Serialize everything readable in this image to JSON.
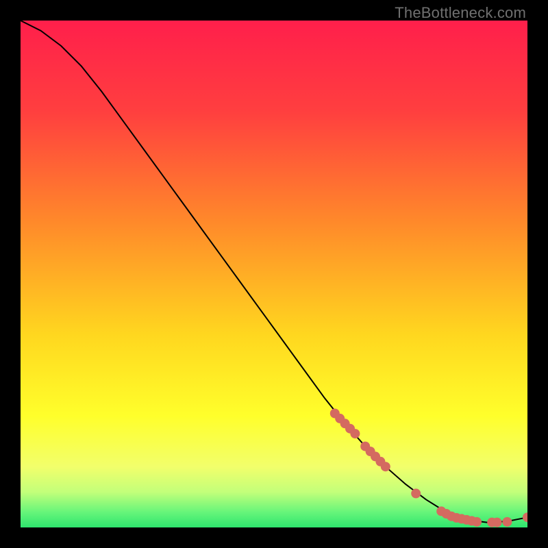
{
  "brand": {
    "watermark": "TheBottleneck.com",
    "gradient_stops": [
      {
        "pct": 0,
        "color": "#ff1f4b"
      },
      {
        "pct": 18,
        "color": "#ff3f3f"
      },
      {
        "pct": 40,
        "color": "#ff8a2a"
      },
      {
        "pct": 62,
        "color": "#ffd71f"
      },
      {
        "pct": 78,
        "color": "#ffff2b"
      },
      {
        "pct": 88,
        "color": "#f2ff6b"
      },
      {
        "pct": 93,
        "color": "#c3ff7a"
      },
      {
        "pct": 97,
        "color": "#66f57a"
      },
      {
        "pct": 100,
        "color": "#2ee56e"
      }
    ],
    "curve_color": "#000000",
    "marker_color": "#d46a60",
    "marker_radius": 7
  },
  "chart_data": {
    "type": "line",
    "title": "",
    "xlabel": "",
    "ylabel": "",
    "xlim": [
      0,
      100
    ],
    "ylim": [
      0,
      100
    ],
    "series": [
      {
        "name": "bottleneck-curve",
        "x": [
          0,
          4,
          8,
          12,
          16,
          20,
          24,
          28,
          32,
          36,
          40,
          44,
          48,
          52,
          56,
          60,
          64,
          68,
          72,
          76,
          80,
          84,
          88,
          92,
          96,
          100
        ],
        "y": [
          100,
          98,
          95,
          91,
          86,
          80.5,
          75,
          69.5,
          64,
          58.5,
          53,
          47.5,
          42,
          36.5,
          31,
          25.5,
          20.5,
          16,
          12,
          8.5,
          5.5,
          3,
          1.5,
          1,
          1.2,
          2
        ]
      }
    ],
    "markers": {
      "name": "highlighted-points",
      "x": [
        62,
        63,
        64,
        65,
        66,
        68,
        69,
        70,
        71,
        72,
        78,
        83,
        84,
        85,
        86,
        87,
        88,
        89,
        90,
        93,
        94,
        96,
        100
      ],
      "y": [
        22.5,
        21.5,
        20.5,
        19.5,
        18.5,
        16,
        15,
        14,
        13,
        12,
        6.7,
        3.2,
        2.7,
        2.2,
        1.9,
        1.7,
        1.5,
        1.3,
        1.1,
        1.0,
        1.0,
        1.1,
        2.0
      ]
    }
  }
}
